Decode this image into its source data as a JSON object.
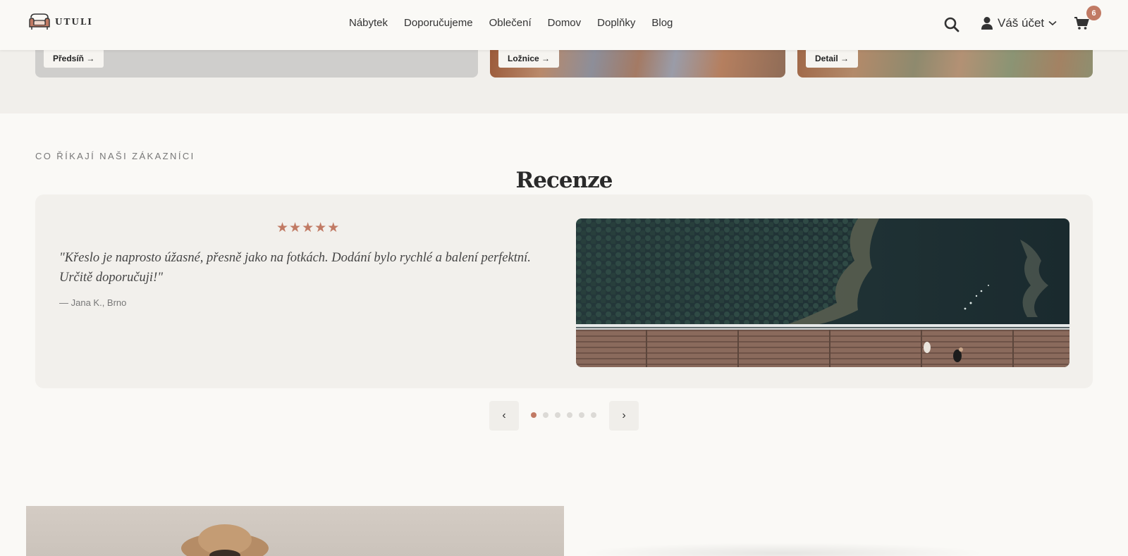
{
  "header": {
    "logo_text": "UTULI",
    "nav": [
      "Nábytek",
      "Doporučujeme",
      "Oblečení",
      "Domov",
      "Doplňky",
      "Blog"
    ],
    "account_label": "Váš účet",
    "cart_count": "6"
  },
  "categories": [
    {
      "label": "Předsíň →"
    },
    {
      "label": "Ložnice →"
    },
    {
      "label": "Detail →"
    }
  ],
  "reviews": {
    "eyebrow": "CO ŘÍKAJÍ NAŠI ZÁKAZNÍCI",
    "title": "Recenze",
    "rating": 5,
    "quote": "\"Křeslo je naprosto úžasné, přesně jako na fotkách. Dodání bylo rychlé a balení perfektní. Určitě doporučuji!\"",
    "author": "— Jana K., Brno",
    "prev_label": "‹",
    "next_label": "›",
    "total_slides": 6,
    "active_slide": 1
  },
  "colors": {
    "accent": "#c17a64",
    "background": "#faf9f6",
    "card": "#f2f0ec"
  }
}
